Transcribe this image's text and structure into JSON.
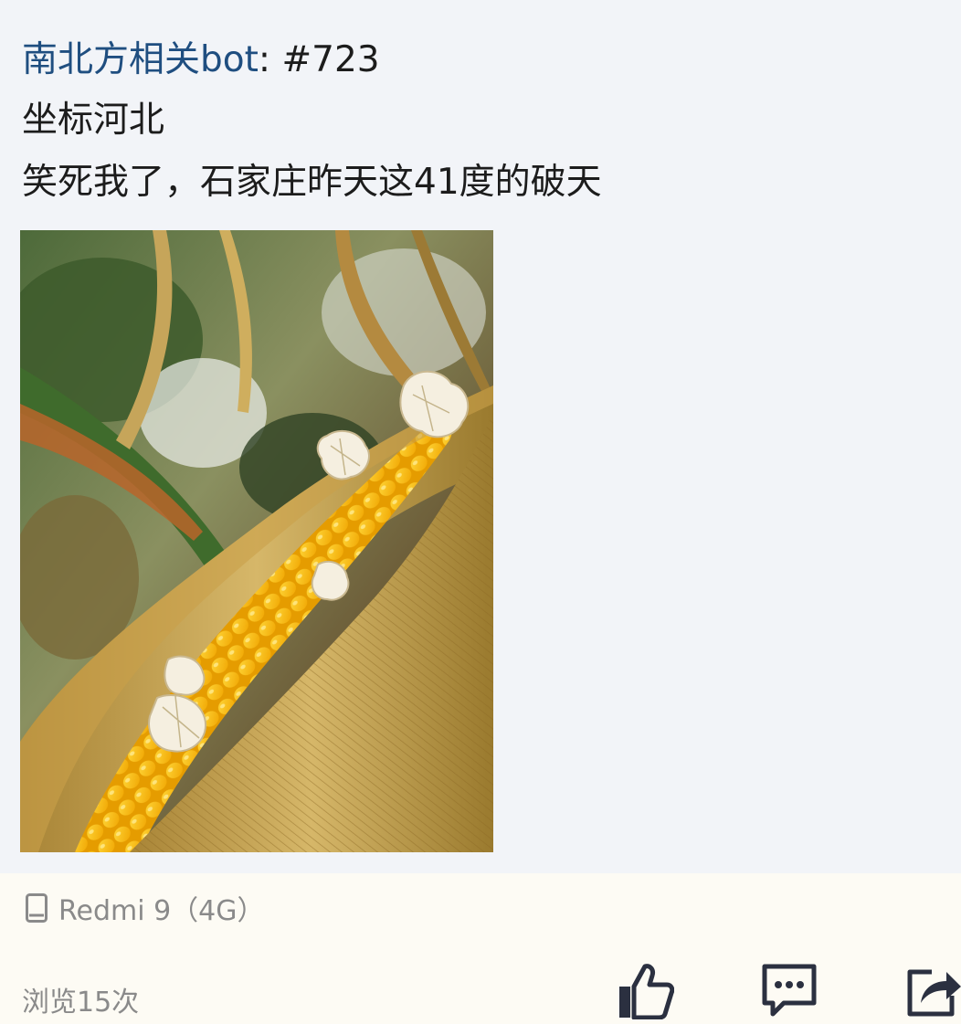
{
  "post": {
    "author": "南北方相关bot",
    "separator": ": ",
    "number": "#723",
    "line1": "坐标河北",
    "line2": "笑死我了，石家庄昨天这41度的破天"
  },
  "footer": {
    "device": "Redmi 9（4G）",
    "views": "浏览15次",
    "device_icon": "phone-icon",
    "like_icon": "thumbs-up-icon",
    "comment_icon": "comment-icon",
    "share_icon": "share-icon"
  },
  "colors": {
    "author_link": "#1f4e80",
    "page_bg": "#f2f4f8",
    "footer_bg": "#fdfbf4",
    "muted_text": "#8a8a8a",
    "icon": "#2b3040"
  }
}
